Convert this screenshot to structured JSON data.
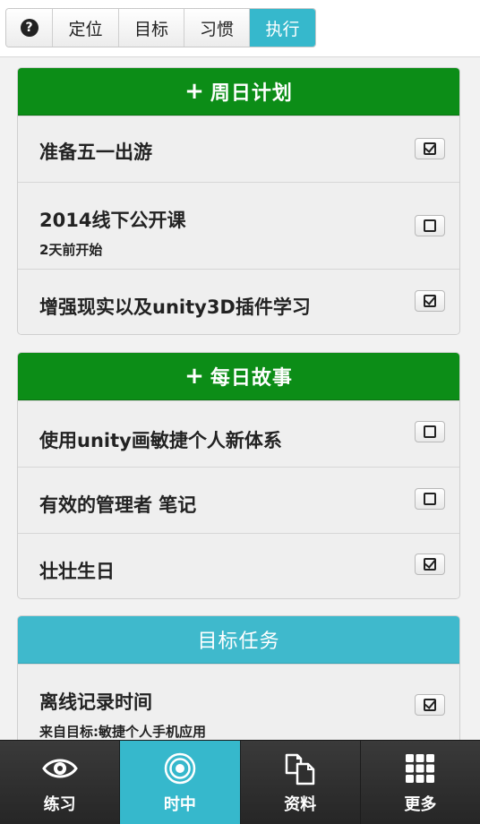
{
  "tabs": {
    "help_icon": "question-icon",
    "items": [
      {
        "label": "定位"
      },
      {
        "label": "目标"
      },
      {
        "label": "习惯"
      },
      {
        "label": "执行"
      }
    ],
    "active_color": "#36b8cc"
  },
  "panels": [
    {
      "title": "周日计划",
      "has_plus": true,
      "color": "#0c8d17",
      "rows": [
        {
          "title": "准备五一出游",
          "sub": "",
          "checked": true
        },
        {
          "title": "2014线下公开课",
          "sub": "2天前开始",
          "checked": false
        },
        {
          "title": "增强现实以及unity3D插件学习",
          "sub": "",
          "checked": true
        }
      ]
    },
    {
      "title": "每日故事",
      "has_plus": true,
      "color": "#0c8d17",
      "rows": [
        {
          "title": "使用unity画敏捷个人新体系",
          "sub": "",
          "checked": false
        },
        {
          "title": "有效的管理者 笔记",
          "sub": "",
          "checked": false
        },
        {
          "title": "壮壮生日",
          "sub": "",
          "checked": true
        }
      ]
    },
    {
      "title": "目标任务",
      "has_plus": false,
      "color": "#3fb9cc",
      "rows": [
        {
          "title": "离线记录时间",
          "sub": "来自目标:敏捷个人手机应用",
          "checked": true
        }
      ]
    }
  ],
  "bottom_nav": [
    {
      "label": "练习",
      "icon": "eye-icon",
      "active": false
    },
    {
      "label": "时中",
      "icon": "target-icon",
      "active": true
    },
    {
      "label": "资料",
      "icon": "documents-icon",
      "active": false
    },
    {
      "label": "更多",
      "icon": "grid-icon",
      "active": false
    }
  ]
}
